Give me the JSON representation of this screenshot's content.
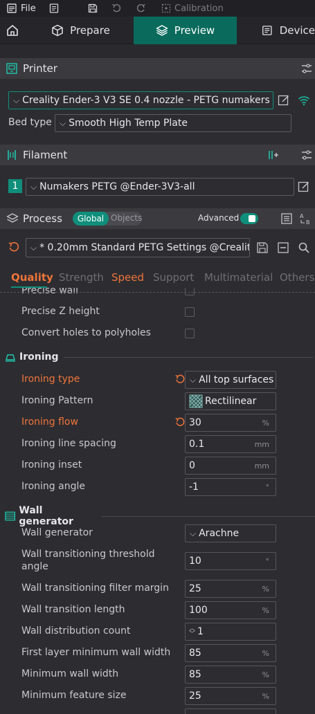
{
  "menubar": {
    "file": "File",
    "calibration": "Calibration"
  },
  "tabs": {
    "prepare": "Prepare",
    "preview": "Preview",
    "device": "Device"
  },
  "printer": {
    "title": "Printer",
    "preset": "Creality Ender-3 V3 SE 0.4 nozzle - PETG numakers",
    "bed_type_label": "Bed type",
    "bed_type": "Smooth High Temp Plate"
  },
  "filament": {
    "title": "Filament",
    "index": "1",
    "preset": "Numakers PETG @Ender-3V3-all"
  },
  "process": {
    "title": "Process",
    "global": "Global",
    "objects": "Objects",
    "advanced": "Advanced",
    "preset": "* 0.20mm Standard PETG Settings @Crealit..."
  },
  "param_tabs": [
    "Quality",
    "Strength",
    "Speed",
    "Support",
    "Multimaterial",
    "Others"
  ],
  "rows": {
    "precise_wall": "Precise wall",
    "precise_z": "Precise Z height",
    "convert_holes": "Convert holes to polyholes"
  },
  "ironing": {
    "title": "Ironing",
    "type_label": "Ironing type",
    "type_value": "All top surfaces",
    "pattern_label": "Ironing Pattern",
    "pattern_value": "Rectilinear",
    "flow_label": "Ironing flow",
    "flow_value": "30",
    "flow_unit": "%",
    "spacing_label": "Ironing line spacing",
    "spacing_value": "0.1",
    "spacing_unit": "mm",
    "inset_label": "Ironing inset",
    "inset_value": "0",
    "inset_unit": "mm",
    "angle_label": "Ironing angle",
    "angle_value": "-1",
    "angle_unit": "°"
  },
  "wallgen": {
    "title": "Wall generator",
    "gen_label": "Wall generator",
    "gen_value": "Arachne",
    "thresh_label_1": "Wall transitioning threshold",
    "thresh_label_2": "angle",
    "thresh_value": "10",
    "thresh_unit": "°",
    "filter_label": "Wall transitioning filter margin",
    "filter_value": "25",
    "filter_unit": "%",
    "length_label": "Wall transition length",
    "length_value": "100",
    "length_unit": "%",
    "dist_label": "Wall distribution count",
    "dist_value": "1",
    "firstlayer_label": "First layer minimum wall width",
    "firstlayer_value": "85",
    "firstlayer_unit": "%",
    "minwall_label": "Minimum wall width",
    "minwall_value": "85",
    "minwall_unit": "%",
    "minfeat_label": "Minimum feature size",
    "minfeat_value": "25",
    "minfeat_unit": "%"
  },
  "colors": {
    "accent": "#0a6b5d",
    "orange": "#f0743a",
    "tab_active": "#f0743a"
  }
}
